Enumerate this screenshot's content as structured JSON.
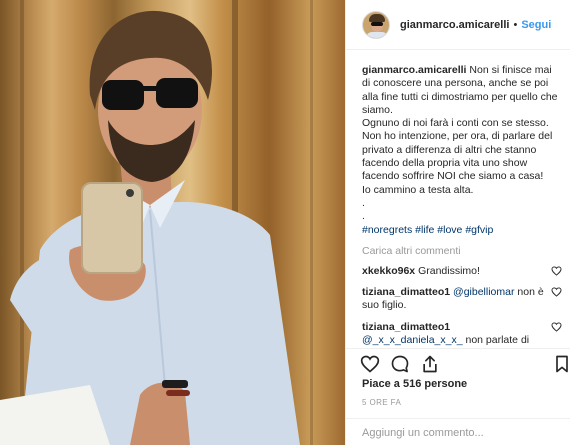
{
  "post": {
    "username": "gianmarco.amicarelli",
    "separator": "•",
    "follow_label": "Segui",
    "caption_user": "gianmarco.amicarelli",
    "caption_lines": [
      "Non si finisce mai di conoscere una persona, anche se poi alla fine tutti ci dimostriamo per quello che siamo.",
      "Ognuno di noi farà i conti con se stesso.",
      "Non ho intenzione, per ora, di parlare del privato a differenza di altri che stanno facendo della propria vita uno show facendo soffrire NOI che siamo a casa!",
      "Io cammino a testa alta.",
      ".",
      "."
    ],
    "hashtags": "#noregrets #life #love #gfvip",
    "load_more": "Carica altri commenti",
    "likes": "Piace a 516 persone",
    "time": "5 ORE FA",
    "add_comment_placeholder": "Aggiungi un commento..."
  },
  "comments": [
    {
      "user": "xkekko96x",
      "mention": "",
      "text": "Grandissimo!"
    },
    {
      "user": "tiziana_dimatteo1",
      "mention": "@gibelliomar",
      "text": "non è suo figlio."
    },
    {
      "user": "tiziana_dimatteo1",
      "mention": "@_x_x_daniela_x_x_",
      "text": "non parlate di ciò che non sapete."
    }
  ],
  "icons": {
    "like": "heart-icon",
    "comment": "comment-bubble-icon",
    "share": "share-icon",
    "save": "bookmark-icon",
    "comment_like": "small-heart-icon"
  },
  "colors": {
    "link": "#3897f0",
    "hashtag": "#003569",
    "muted": "#999999",
    "text": "#262626"
  }
}
